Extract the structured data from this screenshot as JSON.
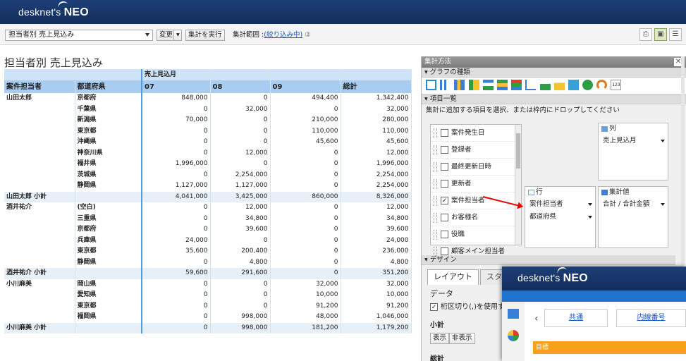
{
  "header": {
    "brand": "desknet's",
    "brand_strong": "NEO"
  },
  "toolbar": {
    "view_select": "担当者別 売上見込み",
    "change_label": "変更",
    "run_label": "集計を実行",
    "range_label": "集計範囲 :",
    "range_link": "(絞り込み中)"
  },
  "page_title": "担当者別 売上見込み",
  "table": {
    "top_header": "売上見込月",
    "headers": [
      "案件担当者",
      "都道府県",
      "07",
      "08",
      "09",
      "総計"
    ],
    "rows": [
      {
        "c1": "山田太郎",
        "c2": "京都府",
        "v": [
          "848,000",
          "0",
          "494,400",
          "1,342,400"
        ]
      },
      {
        "c1": "",
        "c2": "千葉県",
        "v": [
          "0",
          "32,000",
          "0",
          "32,000"
        ]
      },
      {
        "c1": "",
        "c2": "新潟県",
        "v": [
          "70,000",
          "0",
          "210,000",
          "280,000"
        ]
      },
      {
        "c1": "",
        "c2": "東京都",
        "v": [
          "0",
          "0",
          "110,000",
          "110,000"
        ]
      },
      {
        "c1": "",
        "c2": "沖縄県",
        "v": [
          "0",
          "0",
          "45,600",
          "45,600"
        ]
      },
      {
        "c1": "",
        "c2": "神奈川県",
        "v": [
          "0",
          "12,000",
          "0",
          "12,000"
        ]
      },
      {
        "c1": "",
        "c2": "福井県",
        "v": [
          "1,996,000",
          "0",
          "0",
          "1,996,000"
        ]
      },
      {
        "c1": "",
        "c2": "茨城県",
        "v": [
          "0",
          "2,254,000",
          "0",
          "2,254,000"
        ]
      },
      {
        "c1": "",
        "c2": "静岡県",
        "v": [
          "1,127,000",
          "1,127,000",
          "0",
          "2,254,000"
        ]
      },
      {
        "c1": "山田太郎 小計",
        "c2": "",
        "sub": true,
        "v": [
          "4,041,000",
          "3,425,000",
          "860,000",
          "8,326,000"
        ]
      },
      {
        "c1": "酒井祐介",
        "c2": "(空白)",
        "v": [
          "0",
          "12,000",
          "0",
          "12,000"
        ]
      },
      {
        "c1": "",
        "c2": "三重県",
        "v": [
          "0",
          "34,800",
          "0",
          "34,800"
        ]
      },
      {
        "c1": "",
        "c2": "京都府",
        "v": [
          "0",
          "39,600",
          "0",
          "39,600"
        ]
      },
      {
        "c1": "",
        "c2": "兵庫県",
        "v": [
          "24,000",
          "0",
          "0",
          "24,000"
        ]
      },
      {
        "c1": "",
        "c2": "東京都",
        "v": [
          "35,600",
          "200,400",
          "0",
          "236,000"
        ]
      },
      {
        "c1": "",
        "c2": "静岡県",
        "v": [
          "0",
          "4,800",
          "0",
          "4,800"
        ]
      },
      {
        "c1": "酒井祐介 小計",
        "c2": "",
        "sub": true,
        "v": [
          "59,600",
          "291,600",
          "0",
          "351,200"
        ]
      },
      {
        "c1": "小川麻美",
        "c2": "岡山県",
        "v": [
          "0",
          "0",
          "32,000",
          "32,000"
        ]
      },
      {
        "c1": "",
        "c2": "愛知県",
        "v": [
          "0",
          "0",
          "10,000",
          "10,000"
        ]
      },
      {
        "c1": "",
        "c2": "東京都",
        "v": [
          "0",
          "0",
          "91,200",
          "91,200"
        ]
      },
      {
        "c1": "",
        "c2": "福岡県",
        "v": [
          "0",
          "998,000",
          "48,000",
          "1,046,000"
        ]
      },
      {
        "c1": "小川麻美 小計",
        "c2": "",
        "sub": true,
        "v": [
          "0",
          "998,000",
          "181,200",
          "1,179,200"
        ]
      }
    ]
  },
  "panel": {
    "title": "集計方法",
    "graph_section": "グラフの種類",
    "items_section": "項目一覧",
    "items_hint": "集計に追加する項目を選択、または枠内にドロップしてください",
    "items": [
      {
        "label": "案件発生日",
        "checked": false
      },
      {
        "label": "登録者",
        "checked": false
      },
      {
        "label": "最終更新日時",
        "checked": false
      },
      {
        "label": "更新者",
        "checked": false
      },
      {
        "label": "案件担当者",
        "checked": true
      },
      {
        "label": "お客様名",
        "checked": false
      },
      {
        "label": "役職",
        "checked": false
      },
      {
        "label": "顧客メイン担当者",
        "checked": false
      }
    ],
    "col_box": {
      "title": "列",
      "value": "売上見込月"
    },
    "row_box": {
      "title": "行",
      "value1": "案件担当者",
      "value2": "都道府県"
    },
    "agg_box": {
      "title": "集計値",
      "value": "合計 / 合計金額"
    },
    "design_section": "デザイン",
    "tabs": [
      "レイアウト",
      "スタイ"
    ],
    "data_label": "データ",
    "separator_label": "桁区切り(,)を使用す",
    "subtotal_label": "小計",
    "show_label": "表示",
    "hide_label": "非表示",
    "total_label": "総計"
  },
  "mini": {
    "brand": "desknet's",
    "brand_strong": "NEO",
    "tab1": "共通",
    "tab2": "内線番号",
    "goal": "目標"
  },
  "colors": {
    "header": "#1d3f78",
    "accent": "#1a55c6",
    "checked_text": "#222"
  }
}
